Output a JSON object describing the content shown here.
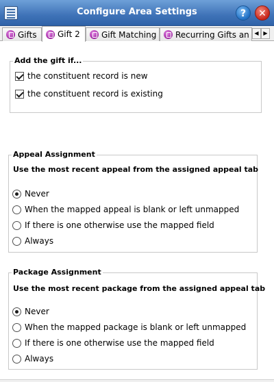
{
  "window": {
    "title": "Configure Area Settings",
    "help_label": "?",
    "close_label": "✕"
  },
  "tabs": [
    {
      "label": "Gifts",
      "active": false
    },
    {
      "label": "Gift 2",
      "active": true
    },
    {
      "label": "Gift Matching",
      "active": false
    },
    {
      "label": "Recurring Gifts an",
      "active": false
    }
  ],
  "tab_scroll": {
    "left": "◀",
    "right": "▶"
  },
  "add_gift": {
    "legend": "Add the gift if...",
    "options": [
      {
        "label": "the constituent record is new",
        "checked": true
      },
      {
        "label": "the constituent record is existing",
        "checked": true
      }
    ]
  },
  "appeal": {
    "legend": "Appeal Assignment",
    "description": "Use the most recent appeal from the assigned appeal tab",
    "options": [
      {
        "label": "Never",
        "selected": true
      },
      {
        "label": "When the mapped appeal is blank or left unmapped",
        "selected": false
      },
      {
        "label": "If there is one otherwise use the mapped field",
        "selected": false
      },
      {
        "label": "Always",
        "selected": false
      }
    ]
  },
  "package": {
    "legend": "Package Assignment",
    "description": "Use the most recent package from the assigned appeal tab",
    "options": [
      {
        "label": "Never",
        "selected": true
      },
      {
        "label": "When the mapped package is blank or left unmapped",
        "selected": false
      },
      {
        "label": "If there is one otherwise use the mapped field",
        "selected": false
      },
      {
        "label": "Always",
        "selected": false
      }
    ]
  }
}
